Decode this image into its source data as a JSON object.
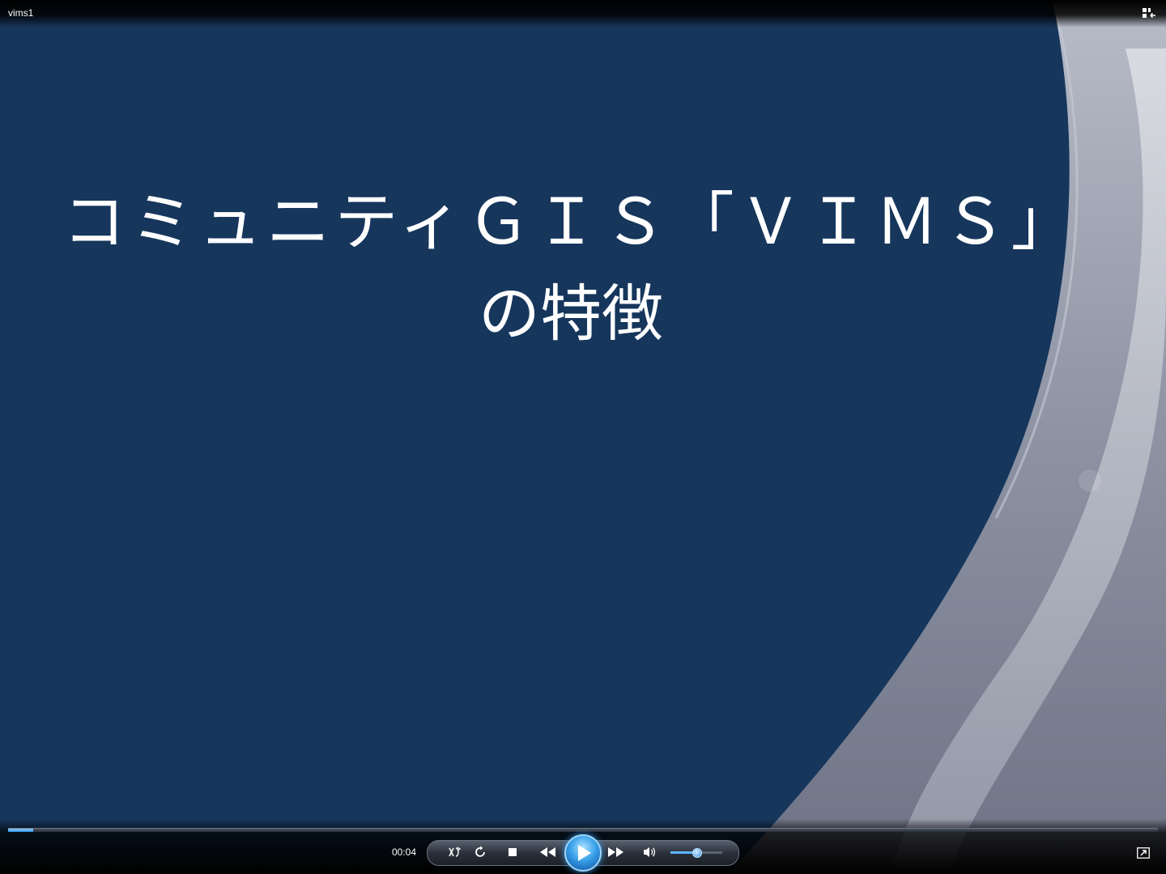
{
  "window": {
    "title": "vims1"
  },
  "slide": {
    "title_line1": "コミュニティＧＩＳ「ＶＩＭＳ」",
    "title_line2": "の特徴",
    "background_color": "#16365c"
  },
  "player": {
    "elapsed_time": "00:04",
    "seek_progress_percent": 2.2,
    "volume_percent": 50,
    "accent_color": "#3aa1ea",
    "icons": {
      "library": "switch-to-library-icon",
      "shuffle": "shuffle-icon",
      "repeat": "repeat-icon",
      "stop": "stop-icon",
      "previous": "previous-icon",
      "play": "play-icon",
      "next": "next-icon",
      "mute": "speaker-icon",
      "fullscreen": "fullscreen-icon"
    }
  }
}
